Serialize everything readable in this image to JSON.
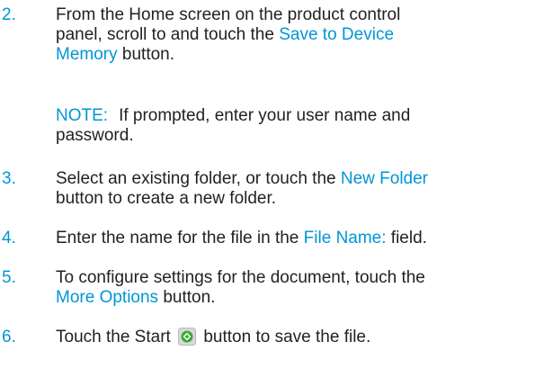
{
  "steps": [
    {
      "number": "2.",
      "parts": [
        "From the Home screen on the product control",
        "panel, scroll to and touch the ",
        "Save to Device",
        "Memory",
        " button."
      ]
    },
    {
      "number": "3.",
      "parts": [
        "Select an existing folder, or touch the ",
        "New Folder",
        "button to create a new folder."
      ]
    },
    {
      "number": "4.",
      "parts": [
        "Enter the name for the file in the ",
        "File Name:",
        " field."
      ]
    },
    {
      "number": "5.",
      "parts": [
        "To configure settings for the document, touch the",
        "More Options",
        " button."
      ]
    },
    {
      "number": "6.",
      "parts": [
        "Touch the Start ",
        " button to save the file."
      ]
    }
  ],
  "note": {
    "label": "NOTE:",
    "text_line1": "If prompted, enter your user name and",
    "text_line2": "password."
  },
  "icons": {
    "start": "start-button-icon"
  },
  "colors": {
    "accent": "#0096d6",
    "text": "#231f20",
    "start_icon_bg": "#d9d9d9",
    "start_icon_fg": "#3aaa35"
  }
}
